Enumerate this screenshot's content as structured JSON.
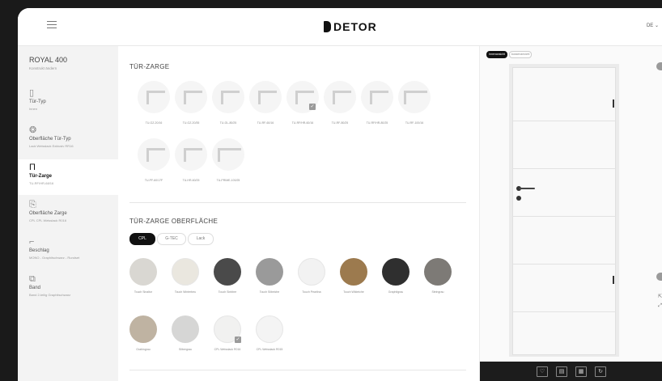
{
  "header": {
    "brand": "DETOR",
    "language": "DE ⌄",
    "menu_icon": "hamburger-icon"
  },
  "sidebar": {
    "product_title": "ROYAL 400",
    "product_sub": "Konstrukt ändern",
    "items": [
      {
        "icon": "door-type-icon",
        "label": "Tür-Typ",
        "sub": "Innen"
      },
      {
        "icon": "surface-icon",
        "label": "Oberfläche Tür-Typ",
        "sub": "Lack Weisslack Exklusiv RR16"
      },
      {
        "icon": "frame-icon",
        "label": "Tür-Zarge",
        "sub": "TU-RF/HR-68/16"
      },
      {
        "icon": "frame-surface-icon",
        "label": "Oberfläche Zarge",
        "sub": "CPL CPL Weisslack R016"
      },
      {
        "icon": "hardware-icon",
        "label": "Beschlag",
        "sub": "MONO - Graphitschwarz - Rundset"
      },
      {
        "icon": "hinge-icon",
        "label": "Band",
        "sub": "Band 2-teilig Graphitschwarz"
      }
    ]
  },
  "frame_section": {
    "title": "TÜR-ZARGE",
    "items": [
      {
        "label": "TU-GZ-20/16"
      },
      {
        "label": "TU-GZ-20/35"
      },
      {
        "label": "TU-GL-80/25"
      },
      {
        "label": "TU-RF-60/16"
      },
      {
        "label": "TU-RF/HR-60/16",
        "selected": true
      },
      {
        "label": "TU-RF-80/25"
      },
      {
        "label": "TU-RF/HR-80/25"
      },
      {
        "label": "TU-RF-100/16"
      },
      {
        "label": "TU-PF-60/17F"
      },
      {
        "label": "TU-HR-60/25"
      },
      {
        "label": "TU-PRIME-100/25"
      }
    ]
  },
  "surface_section": {
    "title": "TÜR-ZARGE OBERFLÄCHE",
    "tabs": [
      {
        "label": "CPL",
        "active": true
      },
      {
        "label": "G-TEC"
      },
      {
        "label": "Lack"
      }
    ],
    "swatches": [
      {
        "label": "Touch Sinaltor",
        "color": "#d9d7d2"
      },
      {
        "label": "Touch Winterbeu",
        "color": "#eae7df"
      },
      {
        "label": "Touch Sinbbre",
        "color": "#4a4a4a"
      },
      {
        "label": "Touch Silbeiche",
        "color": "#9a9a9a"
      },
      {
        "label": "Touch Pearlina",
        "color": "#f2f2f2"
      },
      {
        "label": "Touch Wildeiche",
        "color": "#9c7a4e"
      },
      {
        "label": "Graphitgrau",
        "color": "#2f2f2f"
      },
      {
        "label": "Steingrau",
        "color": "#7d7a76"
      },
      {
        "label": "Grabingrau",
        "color": "#bfb3a2"
      },
      {
        "label": "Silbergrau",
        "color": "#d6d6d5"
      },
      {
        "label": "CPL Weisslack R016",
        "color": "#f1f1f0",
        "selected": true
      },
      {
        "label": "CPL Weisslack R015",
        "color": "#f4f4f4"
      }
    ]
  },
  "preview": {
    "views": [
      {
        "label": "Innenansicht",
        "active": true
      },
      {
        "label": "Aussenansicht"
      }
    ],
    "actions": [
      "heart-icon",
      "document-icon",
      "save-icon",
      "reset-icon"
    ]
  }
}
